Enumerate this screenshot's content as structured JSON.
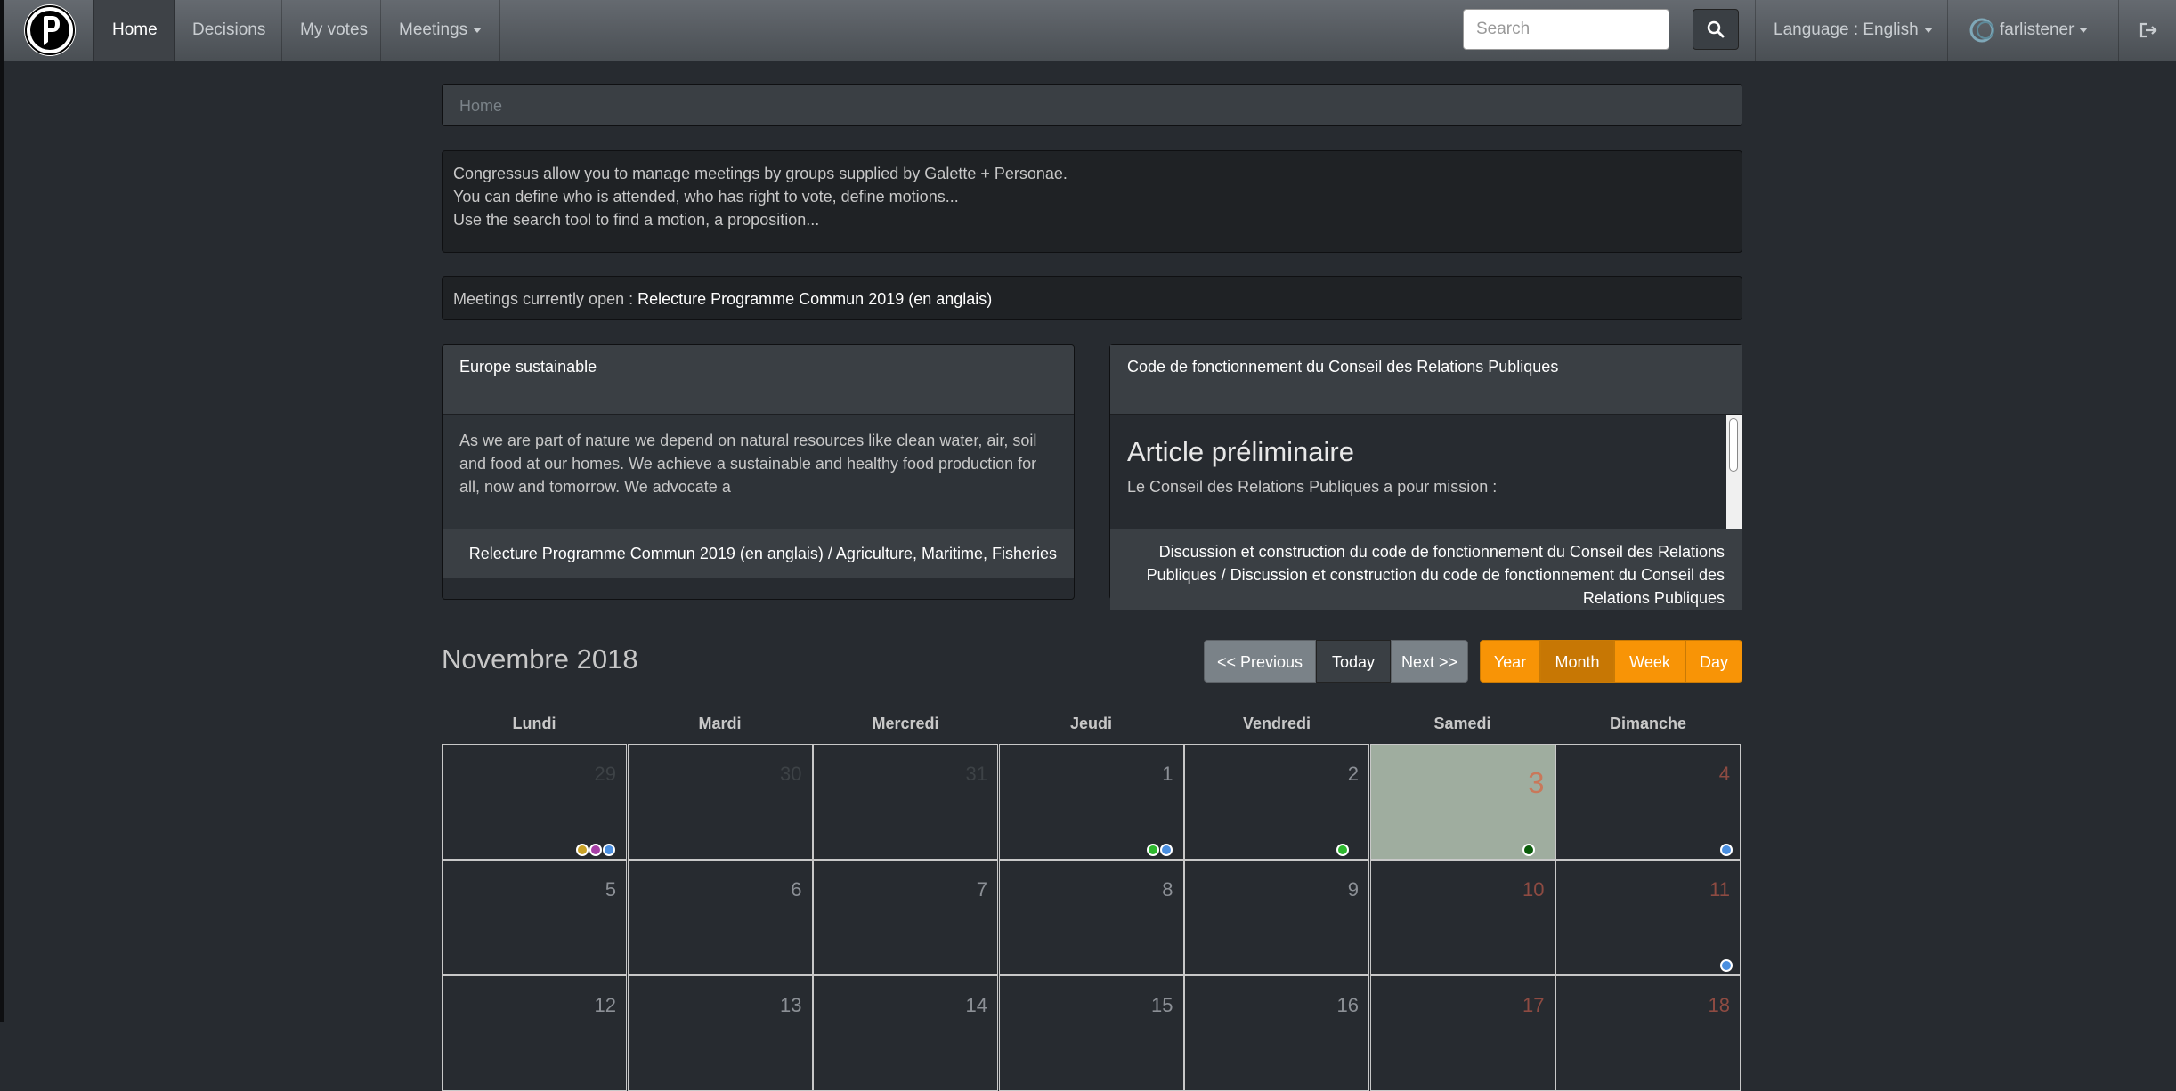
{
  "navbar": {
    "logo": "pirate-party-logo",
    "items": [
      "Home",
      "Decisions",
      "My votes",
      "Meetings"
    ],
    "search_placeholder": "Search",
    "language": "Language : English",
    "user": "farlistener"
  },
  "breadcrumb": "Home",
  "intro": [
    "Congressus allow you to manage meetings by groups supplied by Galette + Personae.",
    "You can define who is attended, who has right to vote, define motions...",
    "Use the search tool to find a motion, a proposition..."
  ],
  "open_meetings": {
    "label": "Meetings currently open : ",
    "meeting": "Relecture Programme Commun 2019 (en anglais)"
  },
  "cards": [
    {
      "title": "Europe sustainable",
      "body": "As we are part of nature we depend on natural resources like clean water, air, soil and food at our homes. We achieve a sustainable and healthy food production for all, now and tomorrow. We advocate a",
      "footer": "Relecture Programme Commun 2019 (en anglais) / Agriculture, Maritime, Fisheries"
    },
    {
      "title": "Code de fonctionnement du Conseil des Relations Publiques",
      "heading": "Article préliminaire",
      "body": "Le Conseil des Relations Publiques a pour mission :",
      "footer": "Discussion et construction du code de fonctionnement du Conseil des Relations Publiques / Discussion et construction du code de fonctionnement du Conseil des Relations Publiques"
    }
  ],
  "calendar": {
    "title": "Novembre 2018",
    "nav": {
      "previous": "<< Previous",
      "today": "Today",
      "next": "Next >>"
    },
    "views": [
      "Year",
      "Month",
      "Week",
      "Day"
    ],
    "active_view": "Month",
    "weekdays": [
      "Lundi",
      "Mardi",
      "Mercredi",
      "Jeudi",
      "Vendredi",
      "Samedi",
      "Dimanche"
    ],
    "weeks": [
      [
        {
          "day": "29",
          "other": true,
          "events": [
            "#c9a227",
            "#a63fa6",
            "#4a8fe0"
          ]
        },
        {
          "day": "30",
          "other": true,
          "events": []
        },
        {
          "day": "31",
          "other": true,
          "events": []
        },
        {
          "day": "1",
          "events": [
            "#2eb82e",
            "#4a8fe0"
          ]
        },
        {
          "day": "2",
          "events": [
            "#2eb82e"
          ]
        },
        {
          "day": "3",
          "today": true,
          "events": [
            "#0a5c0a"
          ]
        },
        {
          "day": "4",
          "events": [
            "#4a8fe0"
          ]
        }
      ],
      [
        {
          "day": "5",
          "events": []
        },
        {
          "day": "6",
          "events": []
        },
        {
          "day": "7",
          "events": []
        },
        {
          "day": "8",
          "events": []
        },
        {
          "day": "9",
          "events": []
        },
        {
          "day": "10",
          "events": []
        },
        {
          "day": "11",
          "events": [
            "#4a8fe0"
          ]
        }
      ],
      [
        {
          "day": "12",
          "events": []
        },
        {
          "day": "13",
          "events": []
        },
        {
          "day": "14",
          "events": []
        },
        {
          "day": "15",
          "events": []
        },
        {
          "day": "16",
          "events": []
        },
        {
          "day": "17",
          "events": []
        },
        {
          "day": "18",
          "events": []
        }
      ]
    ]
  }
}
